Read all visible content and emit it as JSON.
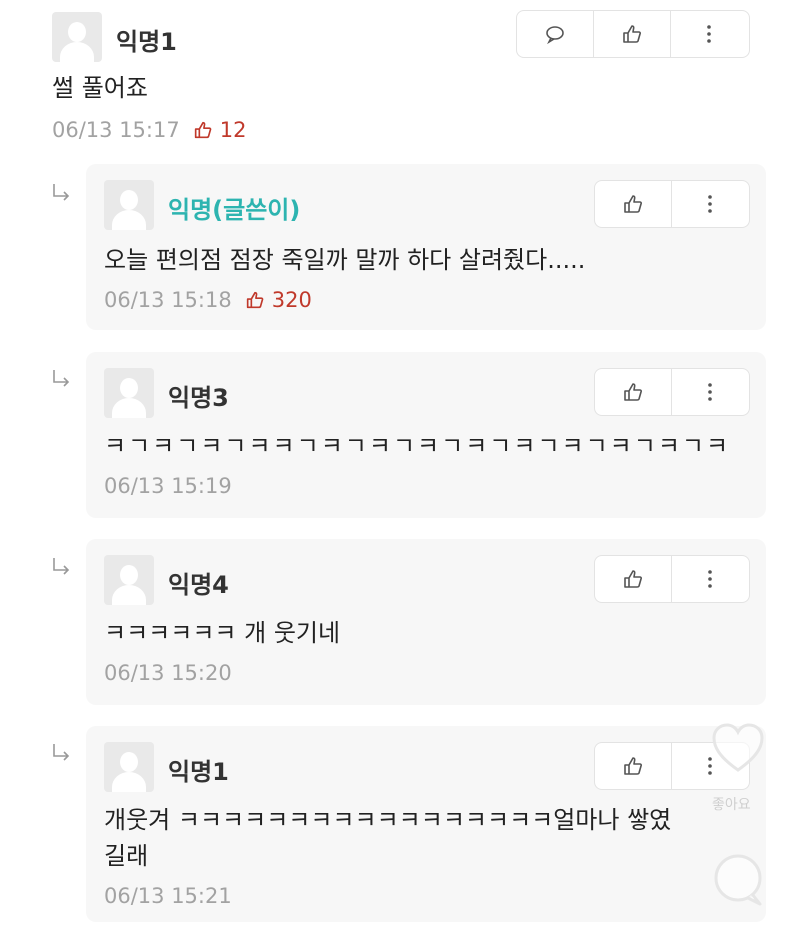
{
  "top": {
    "author": "익명1",
    "text": "썰 풀어죠",
    "time": "06/13 15:17",
    "likes": "12"
  },
  "replies": [
    {
      "author": "익명(글쓴이)",
      "text": "오늘 편의점 점장 죽일까 말까 하다 살려줬다.....",
      "time": "06/13 15:18",
      "likes": "320"
    },
    {
      "author": "익명3",
      "text": "ㅋㄱㅋㄱㅋㄱㅋㅋㄱㅋㄱㅋㄱㅋㄱㅋㄱㅋㄱㅋㄱㅋㄱㅋㄱㅋ",
      "time": "06/13 15:19"
    },
    {
      "author": "익명4",
      "text": "ㅋㅋㅋㅋㅋㅋ 개 웃기네",
      "time": "06/13 15:20"
    },
    {
      "author": "익명1",
      "text_line1": "개웃겨 ㅋㅋㅋㅋㅋㅋㅋㅋㅋㅋㅋㅋㅋㅋㅋㅋㅋ얼마나 쌓였",
      "text_line2": "길래",
      "time": "06/13 15:21"
    }
  ],
  "overlay": {
    "like_label": "좋아요"
  },
  "colors": {
    "op_name": "#2db4b0",
    "like_count": "#c0392b",
    "meta": "#a2a2a2"
  }
}
